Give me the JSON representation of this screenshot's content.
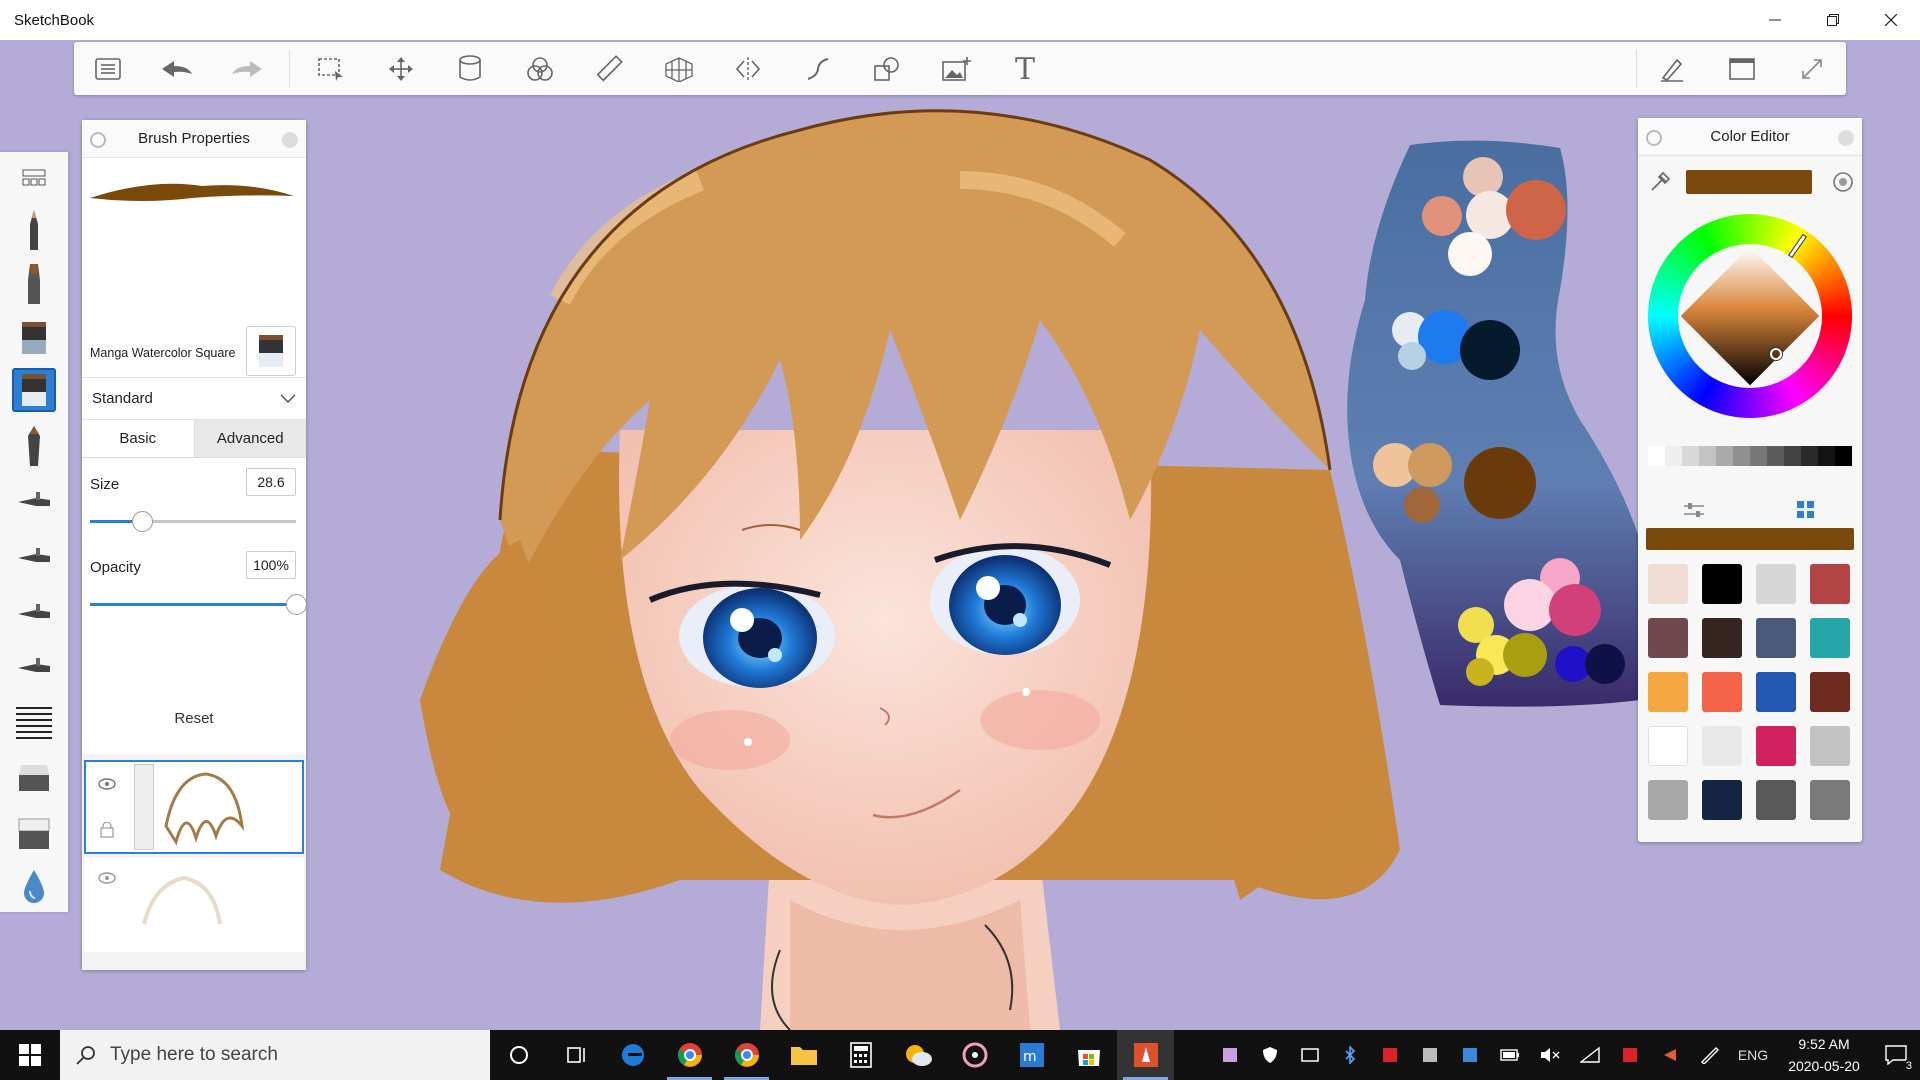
{
  "window": {
    "title": "SketchBook",
    "minimize_icon": "minimize-icon",
    "maximize_icon": "restore-icon",
    "close_icon": "close-icon"
  },
  "toolbar": {
    "items": [
      "menu-icon",
      "undo-icon",
      "redo-icon",
      "select-icon",
      "move-transform-icon",
      "layer-editor-icon",
      "copic-color-icon",
      "ruler-icon",
      "perspective-icon",
      "symmetry-icon",
      "curve-icon",
      "shapes-icon",
      "add-image-icon",
      "text-icon"
    ],
    "text_tool_glyph": "T",
    "right_items": [
      "brush-toggle-icon",
      "window-icon",
      "fullscreen-icon"
    ]
  },
  "brush_properties": {
    "title": "Brush Properties",
    "brush_name": "Manga Watercolor Square",
    "mode": "Standard",
    "tabs": [
      "Basic",
      "Advanced"
    ],
    "active_tab": "Basic",
    "size_label": "Size",
    "size_value": "28.6",
    "size_fraction": 0.25,
    "opacity_label": "Opacity",
    "opacity_value": "100%",
    "opacity_fraction": 1.0,
    "reset_label": "Reset"
  },
  "color_editor": {
    "title": "Color Editor",
    "current_color": "#7a4a0c",
    "grays": [
      "#ffffff",
      "#eeeeee",
      "#d8d8d8",
      "#c4c4c4",
      "#aaaaaa",
      "#909090",
      "#777777",
      "#5c5c5c",
      "#424242",
      "#2a2a2a",
      "#141414",
      "#000000"
    ],
    "palette": [
      "#f0dcd4",
      "#000000",
      "#d6d6d6",
      "#b24446",
      "#6e4a4e",
      "#362420",
      "#4a5a7a",
      "#26a6a6",
      "#f4a641",
      "#f36448",
      "#2456b4",
      "#6e2a1e",
      "#ffffff",
      "#e8e8e8",
      "#d2215e",
      "#c2c2c2",
      "#a8a8a8",
      "#162444",
      "#5a5a5a",
      "#7a7a7a"
    ]
  },
  "taskbar": {
    "search_placeholder": "Type here to search",
    "language": "ENG",
    "time": "9:52 AM",
    "date": "2020-05-20",
    "notification_count": "3"
  }
}
